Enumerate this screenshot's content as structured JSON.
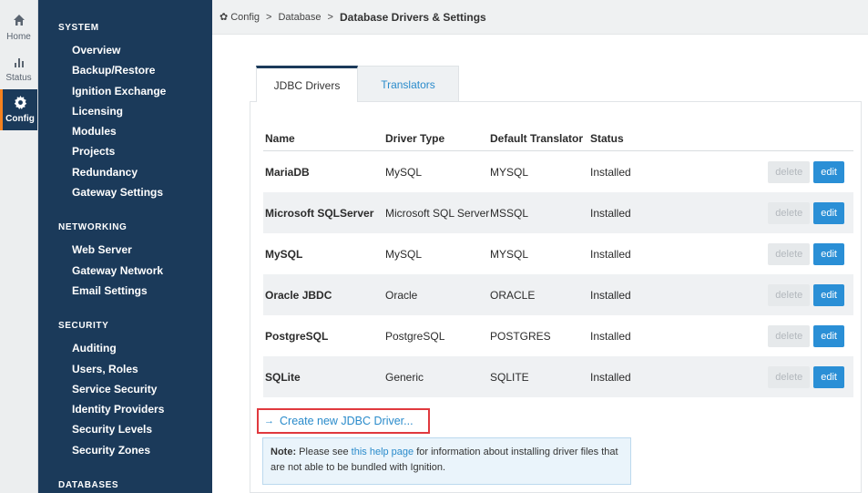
{
  "rail": [
    {
      "label": "Home",
      "icon": "home-icon",
      "glyph": "⌂"
    },
    {
      "label": "Status",
      "icon": "bar-chart-icon",
      "glyph": "▁▆▃"
    },
    {
      "label": "Config",
      "icon": "gear-icon",
      "glyph": "✲"
    }
  ],
  "nav": {
    "system": {
      "heading": "SYSTEM",
      "items": [
        "Overview",
        "Backup/Restore",
        "Ignition Exchange",
        "Licensing",
        "Modules",
        "Projects",
        "Redundancy",
        "Gateway Settings"
      ]
    },
    "networking": {
      "heading": "NETWORKING",
      "items": [
        "Web Server",
        "Gateway Network",
        "Email Settings"
      ]
    },
    "security": {
      "heading": "SECURITY",
      "items": [
        "Auditing",
        "Users, Roles",
        "Service Security",
        "Identity Providers",
        "Security Levels",
        "Security Zones"
      ]
    },
    "databases": {
      "heading": "DATABASES"
    }
  },
  "breadcrumb": {
    "root": "Config",
    "middle": "Database",
    "current": "Database Drivers & Settings",
    "sep": ">",
    "gear": "✿"
  },
  "tabs": [
    "JDBC Drivers",
    "Translators"
  ],
  "table": {
    "headers": [
      "Name",
      "Driver Type",
      "Default Translator",
      "Status"
    ],
    "rows": [
      {
        "name": "MariaDB",
        "type": "MySQL",
        "translator": "MYSQL",
        "status": "Installed"
      },
      {
        "name": "Microsoft SQLServer",
        "type": "Microsoft SQL Server",
        "translator": "MSSQL",
        "status": "Installed"
      },
      {
        "name": "MySQL",
        "type": "MySQL",
        "translator": "MYSQL",
        "status": "Installed"
      },
      {
        "name": "Oracle JBDC",
        "type": "Oracle",
        "translator": "ORACLE",
        "status": "Installed"
      },
      {
        "name": "PostgreSQL",
        "type": "PostgreSQL",
        "translator": "POSTGRES",
        "status": "Installed"
      },
      {
        "name": "SQLite",
        "type": "Generic",
        "translator": "SQLITE",
        "status": "Installed"
      }
    ],
    "delete_label": "delete",
    "edit_label": "edit"
  },
  "create_link": {
    "arrow": "→",
    "label": "Create new JDBC Driver..."
  },
  "note": {
    "bold": "Note:",
    "pre": " Please see ",
    "link": "this help page",
    "post": " for information about installing driver files that are not able to be bundled with Ignition."
  },
  "colors": {
    "nav_bg": "#1b3a5a",
    "accent": "#f5821f",
    "link": "#2a8bcb",
    "edit_btn": "#2a8fd6",
    "highlight_border": "#e0393e"
  }
}
